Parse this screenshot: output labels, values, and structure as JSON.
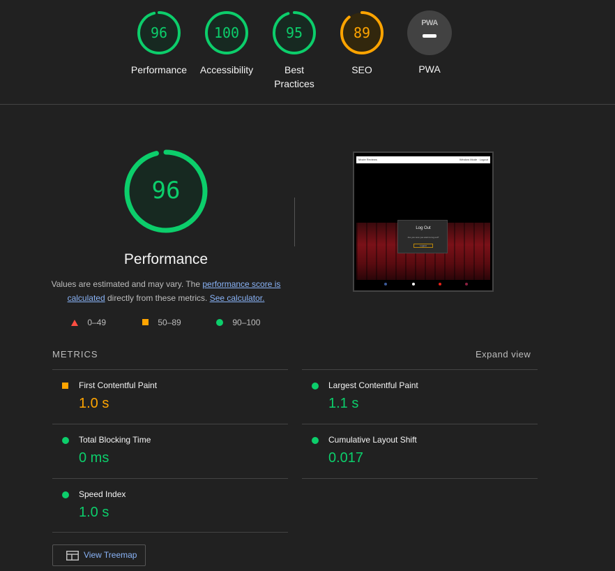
{
  "gauges": [
    {
      "score": "96",
      "label": "Performance",
      "color": "#0cce6b",
      "fraction": 0.96
    },
    {
      "score": "100",
      "label": "Accessibility",
      "color": "#0cce6b",
      "fraction": 1.0
    },
    {
      "score": "95",
      "label": "Best Practices",
      "color": "#0cce6b",
      "fraction": 0.95
    },
    {
      "score": "89",
      "label": "SEO",
      "color": "#ffa400",
      "fraction": 0.89
    }
  ],
  "pwa": {
    "badge_text": "PWA",
    "label": "PWA"
  },
  "main": {
    "score": "96",
    "fraction": 0.96,
    "title": "Performance",
    "desc_prefix": "Values are estimated and may vary. The ",
    "link_score": "performance score is calculated",
    "desc_middle": " directly from these metrics. ",
    "link_calc": "See calculator."
  },
  "legend": {
    "fail": "0–49",
    "average": "50–89",
    "pass": "90–100"
  },
  "thumbnail": {
    "brand": "Movie Reviews",
    "nav_links": "Window Mode · Logout",
    "modal_title": "Log Out",
    "modal_question": "Are you sure you want to log out?",
    "modal_button": "Logout"
  },
  "metrics": {
    "section_title": "METRICS",
    "expand_label": "Expand view",
    "items": [
      {
        "name": "First Contentful Paint",
        "value": "1.0 s",
        "rating": "average"
      },
      {
        "name": "Largest Contentful Paint",
        "value": "1.1 s",
        "rating": "pass"
      },
      {
        "name": "Total Blocking Time",
        "value": "0 ms",
        "rating": "pass"
      },
      {
        "name": "Cumulative Layout Shift",
        "value": "0.017",
        "rating": "pass"
      },
      {
        "name": "Speed Index",
        "value": "1.0 s",
        "rating": "pass"
      }
    ]
  },
  "treemap": {
    "label": "View Treemap"
  },
  "colors": {
    "pass": "#0cce6b",
    "average": "#ffa400",
    "fail": "#ff4e42",
    "link": "#8ab4f8"
  }
}
